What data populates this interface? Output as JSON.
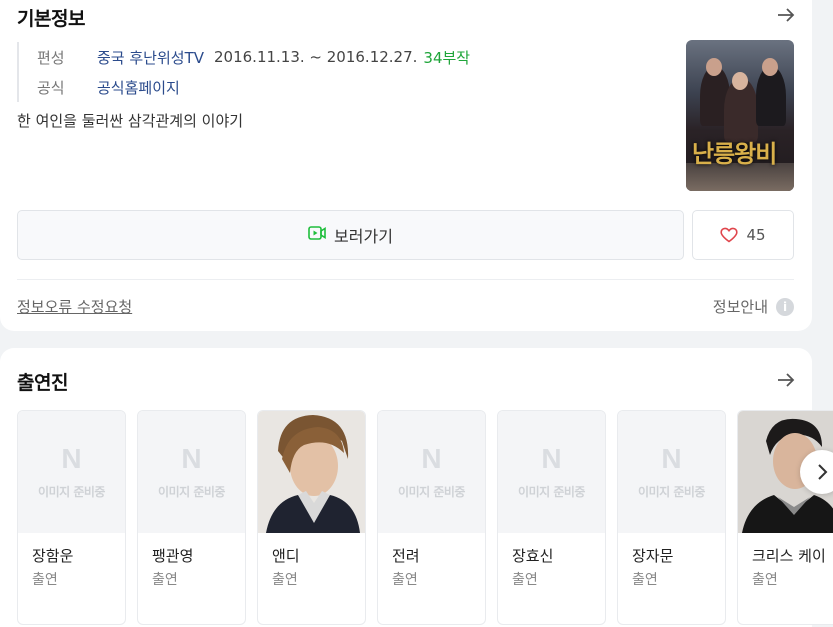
{
  "info": {
    "title": "기본정보",
    "meta": {
      "broadcast_key": "편성",
      "broadcast_channel": "중국 후난위성TV",
      "broadcast_period": "2016.11.13. ~ 2016.12.27.",
      "episodes": "34부작",
      "official_key": "공식",
      "official_link": "공식홈페이지"
    },
    "description": "한 여인을 둘러싼 삼각관계의 이야기",
    "poster_title": "난릉왕비",
    "watch_label": "보러가기",
    "like_count": "45",
    "report_link": "정보오류 수정요청",
    "info_guide": "정보안내",
    "info_icon_glyph": "i"
  },
  "cast": {
    "title": "출연진",
    "placeholder_letter": "N",
    "placeholder_text": "이미지 준비중",
    "items": [
      {
        "name": "장함운",
        "role": "출연",
        "has_photo": false
      },
      {
        "name": "팽관영",
        "role": "출연",
        "has_photo": false
      },
      {
        "name": "앤디",
        "role": "출연",
        "has_photo": true
      },
      {
        "name": "전려",
        "role": "출연",
        "has_photo": false
      },
      {
        "name": "장효신",
        "role": "출연",
        "has_photo": false
      },
      {
        "name": "장자문",
        "role": "출연",
        "has_photo": false
      },
      {
        "name": "크리스 케이",
        "role": "출연",
        "has_photo": true
      }
    ]
  },
  "colors": {
    "link": "#2b4b8c",
    "episodes": "#1fa53a",
    "heart": "#e0454c",
    "play": "#1fbe3c"
  }
}
